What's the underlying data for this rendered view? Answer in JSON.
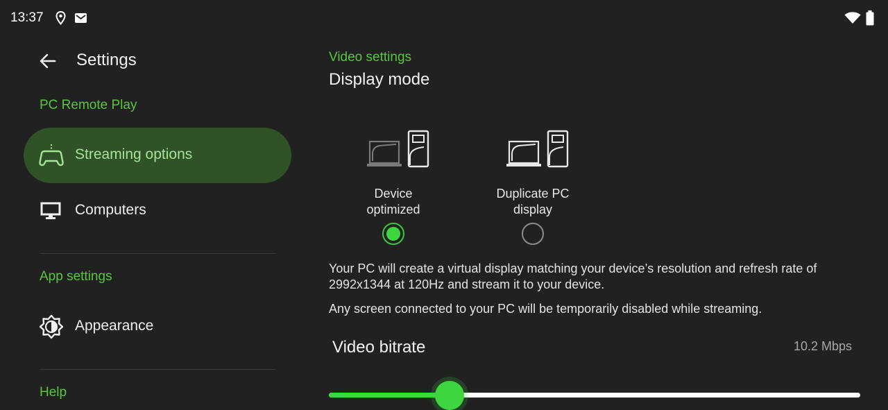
{
  "status_bar": {
    "time": "13:37",
    "icons": [
      "location-icon",
      "mail-icon",
      "wifi-icon",
      "battery-icon"
    ]
  },
  "nav": {
    "title": "Settings",
    "sections": [
      {
        "label": "PC Remote Play"
      },
      {
        "label": "App settings"
      },
      {
        "label": "Help"
      }
    ],
    "items": [
      {
        "label": "Streaming options",
        "icon": "gamepad-icon",
        "active": true
      },
      {
        "label": "Computers",
        "icon": "monitor-icon",
        "active": false
      },
      {
        "label": "Appearance",
        "icon": "brightness-icon",
        "active": false
      }
    ]
  },
  "panel": {
    "section_label": "Video settings",
    "display_mode": {
      "title": "Display mode",
      "options": [
        {
          "label": "Device\noptimized",
          "selected": true
        },
        {
          "label": "Duplicate PC\ndisplay",
          "selected": false
        }
      ],
      "description_1": "Your PC will create a virtual display matching your device’s resolution and refresh rate of 2992x1344 at 120Hz and stream it to your device.",
      "description_2": "Any screen connected to your PC will be temporarily disabled while streaming."
    },
    "bitrate": {
      "label": "Video bitrate",
      "value_text": "10.2 Mbps",
      "slider_fraction": 0.227
    }
  },
  "colors": {
    "accent": "#55c83a",
    "active_bg": "#2f5227",
    "slider": "#3ed63e",
    "background": "#212121"
  }
}
